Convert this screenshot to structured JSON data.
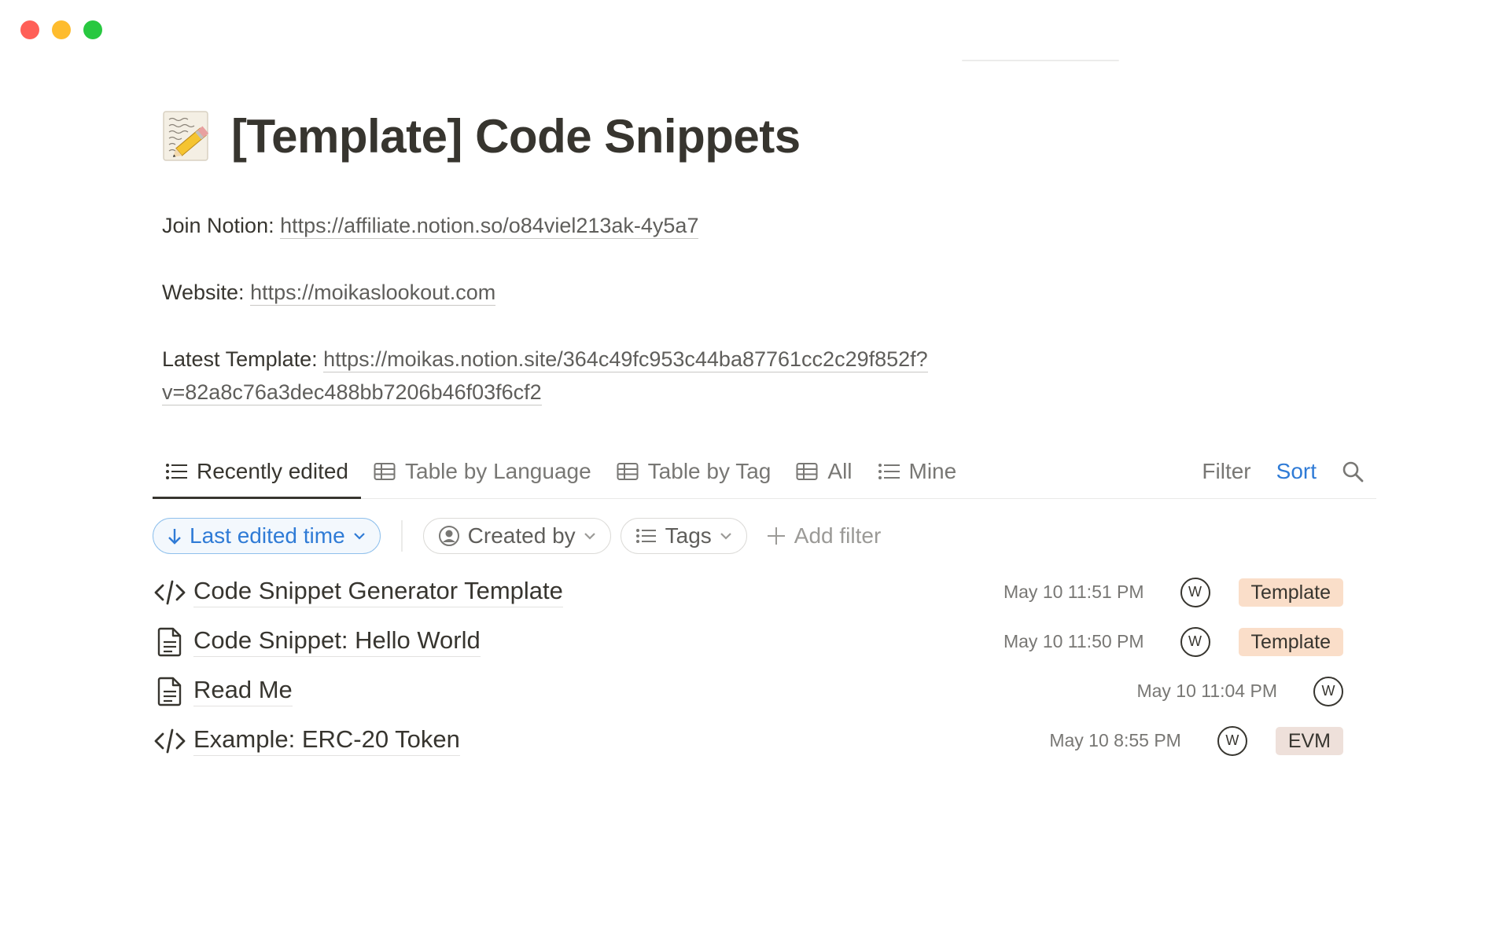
{
  "window": {
    "controls": [
      "close",
      "minimize",
      "maximize"
    ]
  },
  "page": {
    "icon": "memo-pencil-icon",
    "title": "[Template] Code Snippets"
  },
  "info": {
    "join_label": "Join Notion: ",
    "join_url": "https://affiliate.notion.so/o84viel213ak-4y5a7",
    "website_label": "Website: ",
    "website_url": "https://moikaslookout.com",
    "latest_label": "Latest Template: ",
    "latest_url_line1": "https://moikas.notion.site/364c49fc953c44ba87761cc2c29f852f?",
    "latest_url_line2": "v=82a8c76a3dec488bb7206b46f03f6cf2"
  },
  "views": {
    "tabs": [
      {
        "label": "Recently edited",
        "icon": "list-icon",
        "active": true
      },
      {
        "label": "Table by Language",
        "icon": "table-icon",
        "active": false
      },
      {
        "label": "Table by Tag",
        "icon": "table-icon",
        "active": false
      },
      {
        "label": "All",
        "icon": "table-icon",
        "active": false
      },
      {
        "label": "Mine",
        "icon": "list-icon",
        "active": false
      }
    ],
    "filter_label": "Filter",
    "sort_label": "Sort",
    "search_icon": "search-icon"
  },
  "filters": {
    "sort_pill": "Last edited time",
    "created_by": "Created by",
    "tags": "Tags",
    "add_filter": "Add filter"
  },
  "rows": [
    {
      "title": "Code Snippet Generator Template",
      "icon": "code-icon",
      "date": "May 10 11:51 PM",
      "avatar": "W",
      "tag": "Template",
      "tag_color": "#fadec9"
    },
    {
      "title": "Code Snippet: Hello World",
      "icon": "page-icon",
      "date": "May 10 11:50 PM",
      "avatar": "W",
      "tag": "Template",
      "tag_color": "#fadec9"
    },
    {
      "title": "Read Me",
      "icon": "page-icon",
      "date": "May 10 11:04 PM",
      "avatar": "W",
      "tag": "",
      "tag_color": ""
    },
    {
      "title": "Example: ERC-20 Token",
      "icon": "code-icon",
      "date": "May 10 8:55 PM",
      "avatar": "W",
      "tag": "EVM",
      "tag_color": "#eee0da"
    }
  ],
  "colors": {
    "accent_blue": "#2f7bd6",
    "text": "#37352f",
    "muted": "#787774"
  }
}
